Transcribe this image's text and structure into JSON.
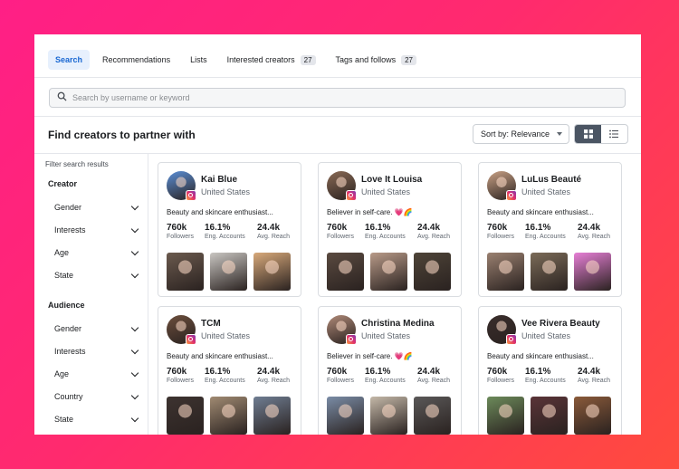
{
  "tabs": [
    {
      "label": "Search",
      "active": true
    },
    {
      "label": "Recommendations"
    },
    {
      "label": "Lists"
    },
    {
      "label": "Interested creators",
      "count": "27"
    },
    {
      "label": "Tags and follows",
      "count": "27"
    }
  ],
  "search": {
    "placeholder": "Search by username or keyword"
  },
  "main": {
    "heading": "Find creators to partner with",
    "sort_label": "Sort by: Relevance"
  },
  "sidebar": {
    "title": "Filter search results",
    "creator": {
      "title": "Creator",
      "items": [
        "Gender",
        "Interests",
        "Age",
        "State"
      ]
    },
    "audience": {
      "title": "Audience",
      "items": [
        "Gender",
        "Interests",
        "Age",
        "Country",
        "State"
      ]
    }
  },
  "stat_labels": {
    "followers": "Followers",
    "eng": "Eng. Accounts",
    "reach": "Avg. Reach"
  },
  "creators": [
    {
      "name": "Kai Blue",
      "location": "United States",
      "bio": "Beauty and skincare enthusiast...",
      "followers": "760k",
      "eng": "16.1%",
      "reach": "24.4k",
      "avatar_color": "#5b8fd6",
      "photos": [
        "#6b5a4e",
        "#c9c6c2",
        "#d8a97a"
      ]
    },
    {
      "name": "Love It Louisa",
      "location": "United States",
      "bio": "Believer in self-care. 💗🌈",
      "followers": "760k",
      "eng": "16.1%",
      "reach": "24.4k",
      "avatar_color": "#8a6a55",
      "photos": [
        "#5a4a40",
        "#b89a88",
        "#4e4438"
      ]
    },
    {
      "name": "LuLus Beauté",
      "location": "United States",
      "bio": "Beauty and skincare enthusiast...",
      "followers": "760k",
      "eng": "16.1%",
      "reach": "24.4k",
      "avatar_color": "#c9a185",
      "photos": [
        "#9a8070",
        "#7b6b58",
        "#e77fd6"
      ]
    },
    {
      "name": "TCM",
      "location": "United States",
      "bio": "Beauty and skincare enthusiast...",
      "followers": "760k",
      "eng": "16.1%",
      "reach": "24.4k",
      "avatar_color": "#6d4f3d",
      "photos": [
        "#3d3330",
        "#a08a72",
        "#6f7d92"
      ]
    },
    {
      "name": "Christina Medina",
      "location": "United States",
      "bio": "Believer in self-care. 💗🌈",
      "followers": "760k",
      "eng": "16.1%",
      "reach": "24.4k",
      "avatar_color": "#b08a78",
      "photos": [
        "#7a8ca6",
        "#c4b8a8",
        "#5a5858"
      ]
    },
    {
      "name": "Vee Rivera Beauty",
      "location": "United States",
      "bio": "Beauty and skincare enthusiast...",
      "followers": "760k",
      "eng": "16.1%",
      "reach": "24.4k",
      "avatar_color": "#3a2e2c",
      "photos": [
        "#6c8a5a",
        "#5a3438",
        "#8a5a3a"
      ]
    }
  ],
  "colors": {
    "accent": "#1967d2",
    "tab_active_bg": "#e7f0fd",
    "view_active": "#4b5563"
  }
}
